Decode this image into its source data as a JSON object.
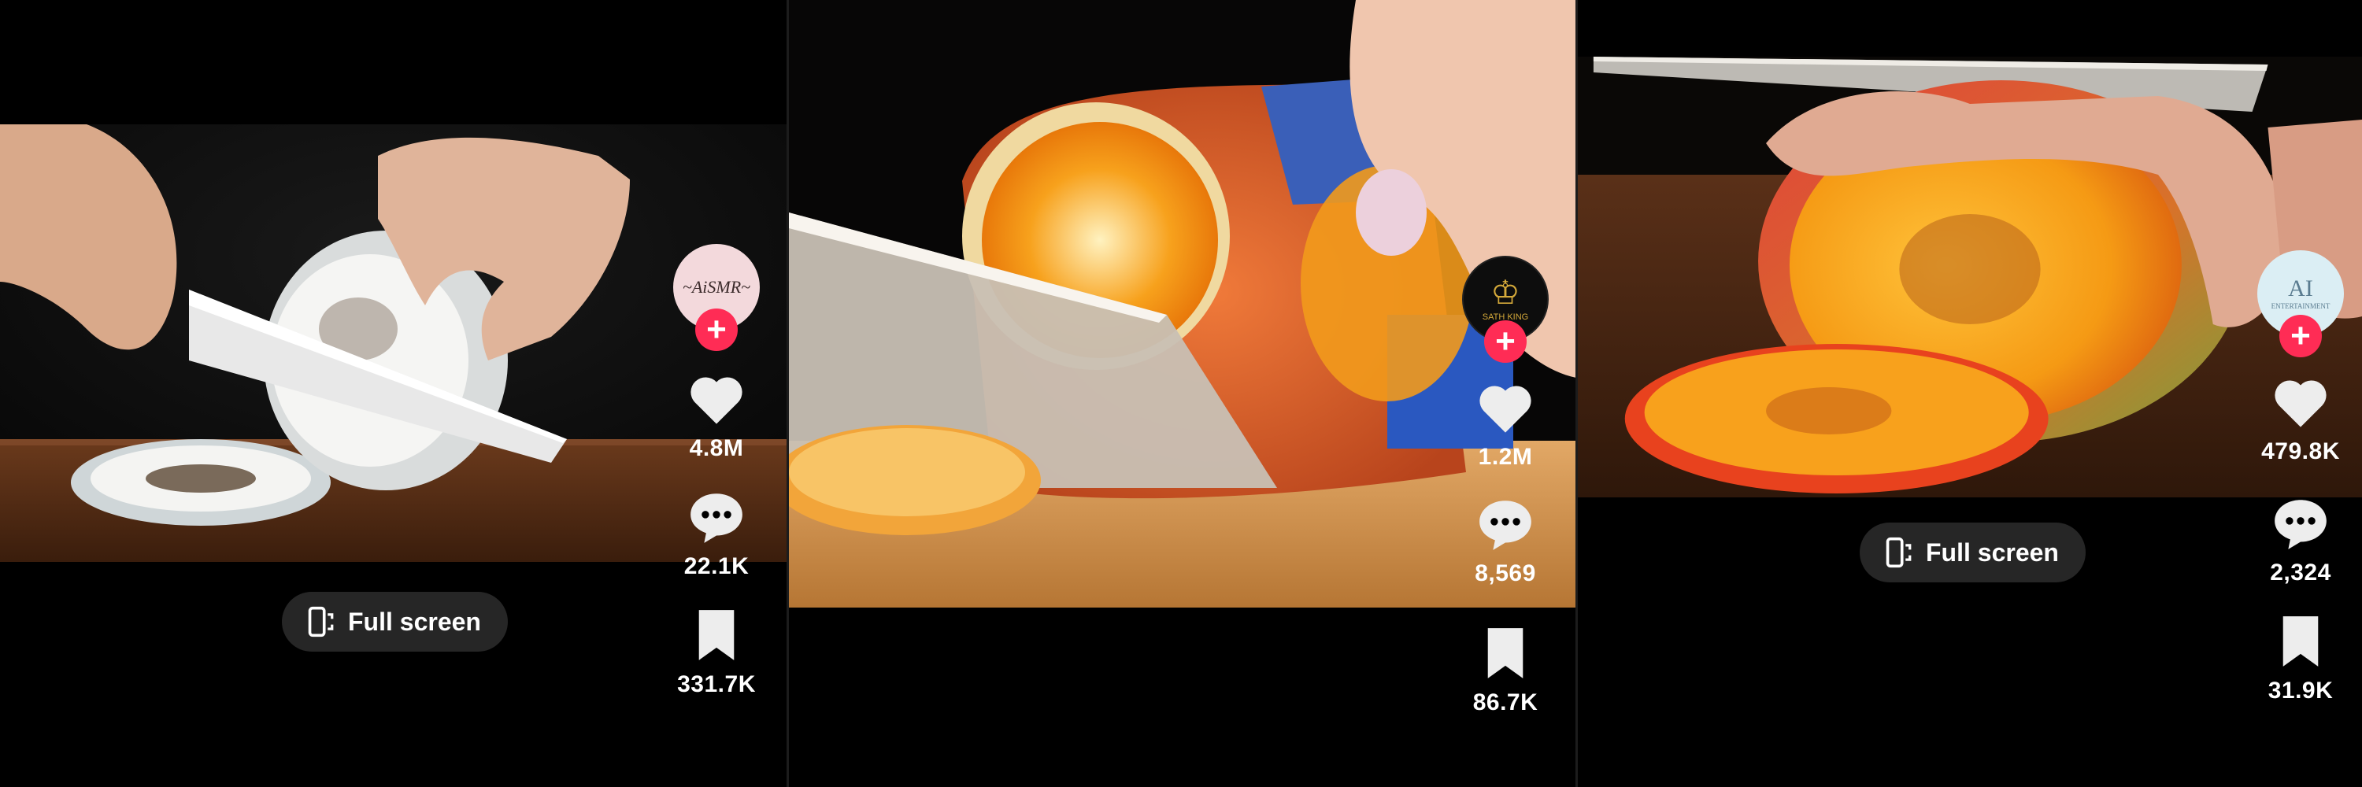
{
  "fullscreen_label": "Full screen",
  "colors": {
    "follow": "#ff2c55",
    "icon": "#ededed",
    "background": "#000000"
  },
  "panels": [
    {
      "avatar_text": "~AiSMR~",
      "avatar_icon": "aismr-logo-icon",
      "likes": "4.8M",
      "comments": "22.1K",
      "saves": "331.7K"
    },
    {
      "avatar_text": "SATH KING",
      "avatar_icon": "lion-crest-icon",
      "likes": "1.2M",
      "comments": "8,569",
      "saves": "86.7K"
    },
    {
      "avatar_text": "AI",
      "avatar_subtext": "ENTERTAINMENT",
      "avatar_icon": "ai-entertainment-logo-icon",
      "likes": "479.8K",
      "comments": "2,324",
      "saves": "31.9K"
    }
  ]
}
